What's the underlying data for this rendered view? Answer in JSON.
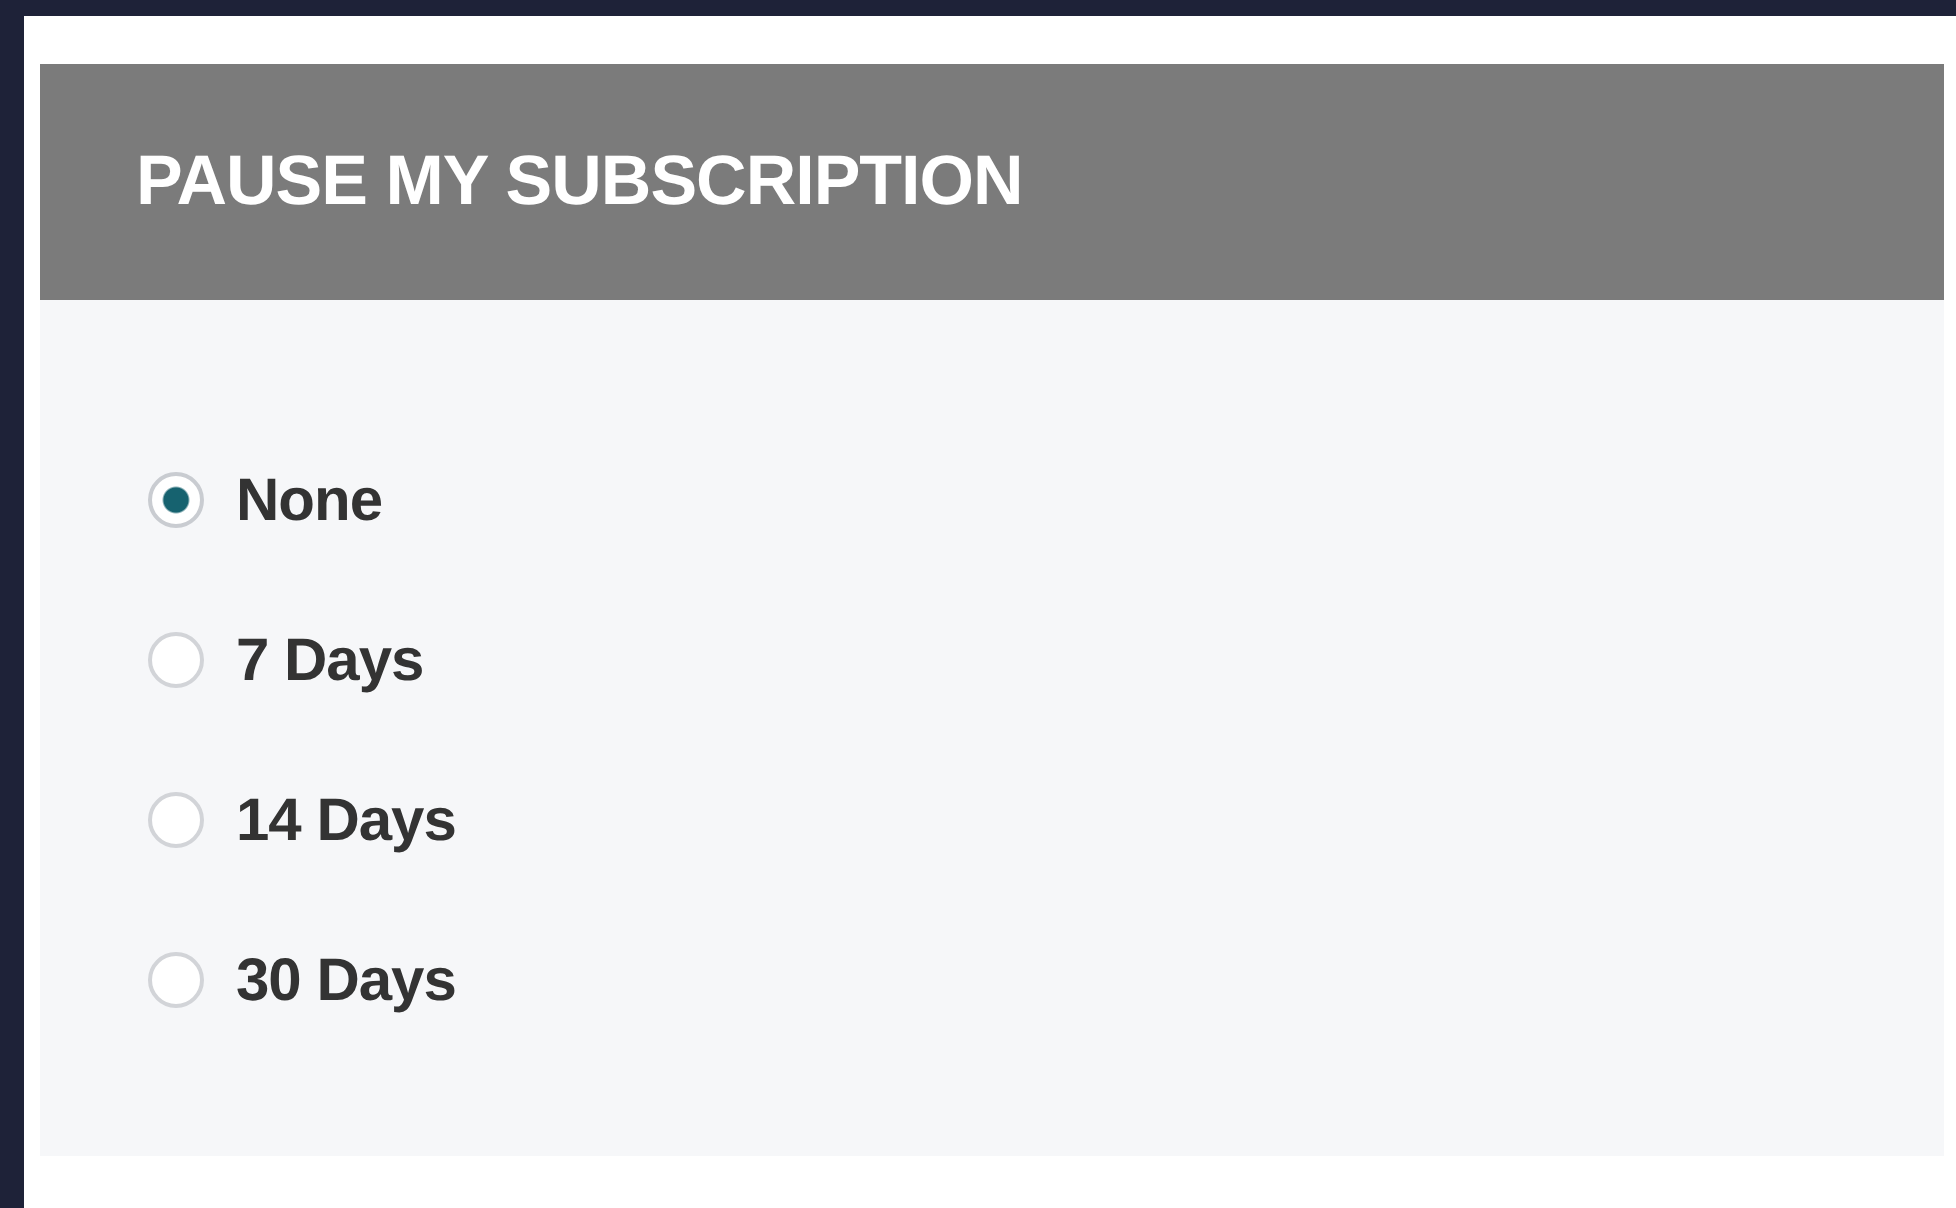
{
  "panel": {
    "title": "PAUSE MY SUBSCRIPTION"
  },
  "options": [
    {
      "label": "None",
      "selected": true
    },
    {
      "label": "7 Days",
      "selected": false
    },
    {
      "label": "14 Days",
      "selected": false
    },
    {
      "label": "30 Days",
      "selected": false
    }
  ]
}
